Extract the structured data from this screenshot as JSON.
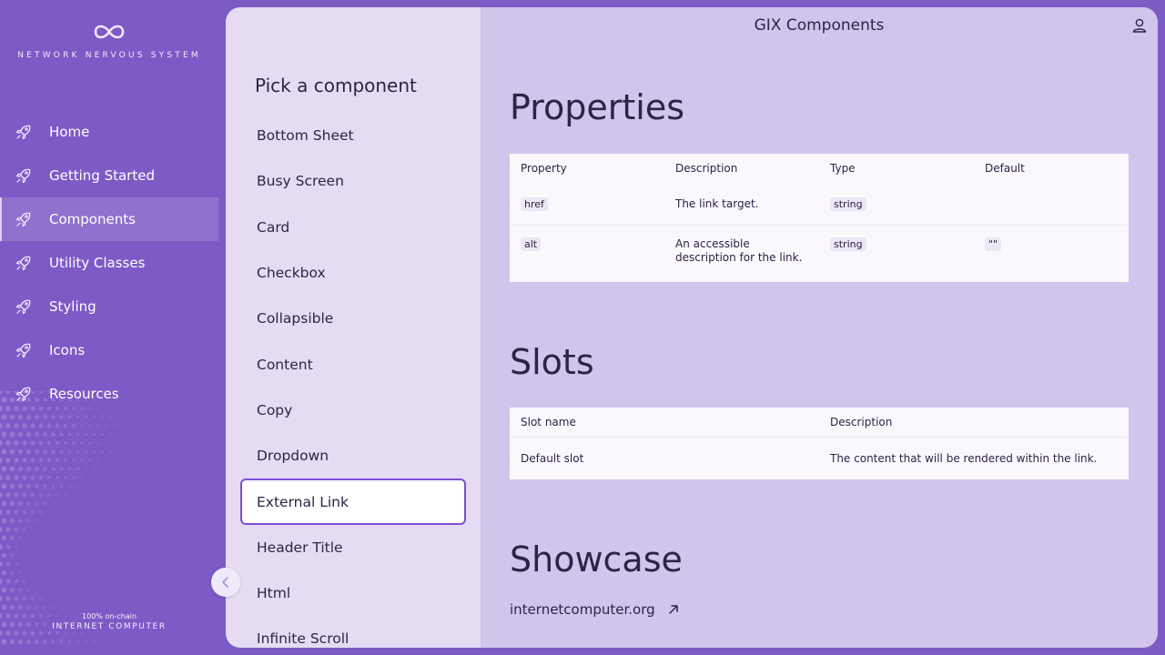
{
  "nav": {
    "logo_text": "NETWORK NERVOUS SYSTEM",
    "items": [
      {
        "label": "Home",
        "icon": "rocket-icon"
      },
      {
        "label": "Getting Started",
        "icon": "rocket-icon"
      },
      {
        "label": "Components",
        "icon": "rocket-icon",
        "selected": true
      },
      {
        "label": "Utility Classes",
        "icon": "rocket-icon"
      },
      {
        "label": "Styling",
        "icon": "rocket-icon"
      },
      {
        "label": "Icons",
        "icon": "rocket-icon"
      },
      {
        "label": "Resources",
        "icon": "rocket-icon"
      }
    ],
    "footer_small": "100% on-chain",
    "footer_big": "INTERNET COMPUTER"
  },
  "picker": {
    "title": "Pick a component",
    "items": [
      "Bottom Sheet",
      "Busy Screen",
      "Card",
      "Checkbox",
      "Collapsible",
      "Content",
      "Copy",
      "Dropdown",
      "External Link",
      "Header Title",
      "Html",
      "Infinite Scroll"
    ],
    "selected": "External Link"
  },
  "main": {
    "title": "GIX Components",
    "properties": {
      "heading": "Properties",
      "columns": [
        "Property",
        "Description",
        "Type",
        "Default"
      ],
      "rows": [
        {
          "property": "href",
          "description": "The link target.",
          "type": "string",
          "default": ""
        },
        {
          "property": "alt",
          "description": "An accessible description for the link.",
          "type": "string",
          "default": "\"\""
        }
      ]
    },
    "slots": {
      "heading": "Slots",
      "columns": [
        "Slot name",
        "Description"
      ],
      "rows": [
        {
          "name": "Default slot",
          "description": "The content that will be rendered within the link."
        }
      ]
    },
    "showcase": {
      "heading": "Showcase",
      "link_text": "internetcomputer.org"
    }
  },
  "colors": {
    "nav_bg": "#7d5ac6",
    "picker_bg": "#e5dcf4",
    "main_bg": "#d1c5ec",
    "accent": "#7b4fd6"
  }
}
